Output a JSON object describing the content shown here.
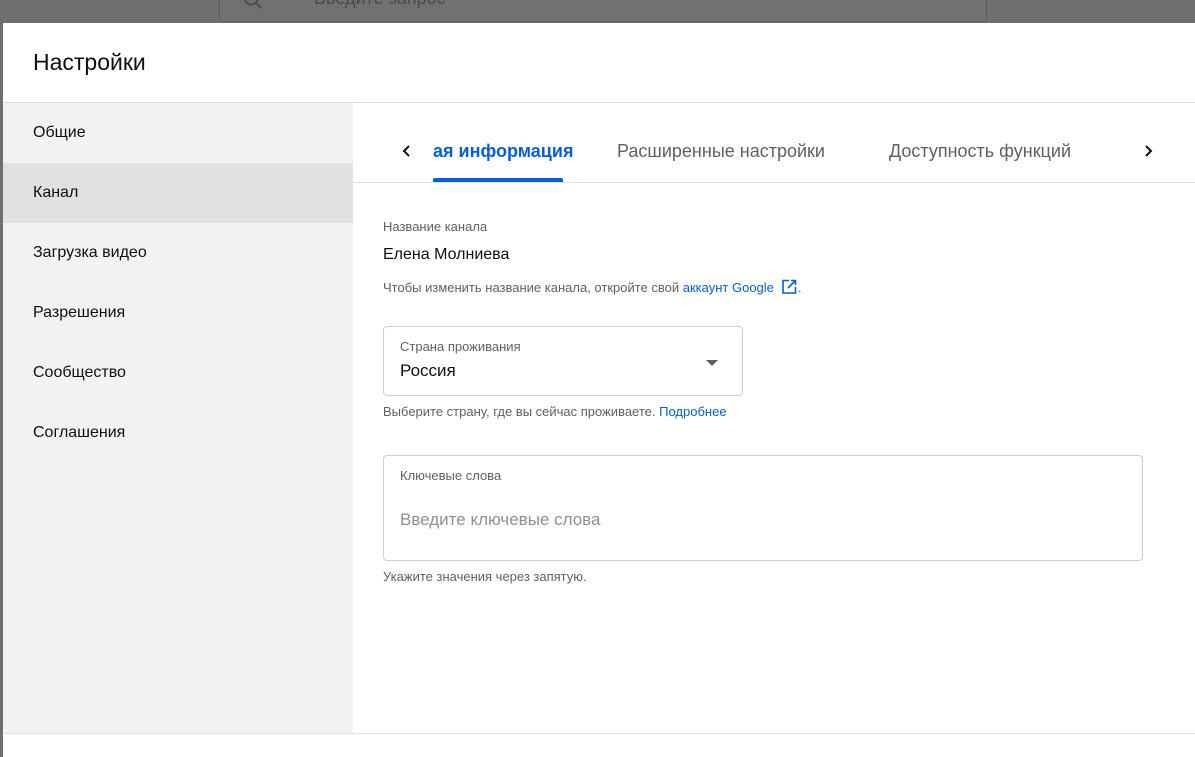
{
  "background": {
    "search_placeholder": "Введите запрос"
  },
  "dialog": {
    "title": "Настройки"
  },
  "sidebar": {
    "items": [
      {
        "label": "Общие",
        "active": false
      },
      {
        "label": "Канал",
        "active": true
      },
      {
        "label": "Загрузка видео",
        "active": false
      },
      {
        "label": "Разрешения",
        "active": false
      },
      {
        "label": "Сообщество",
        "active": false
      },
      {
        "label": "Соглашения",
        "active": false
      }
    ]
  },
  "tabs": {
    "items": [
      {
        "label": "ая информация",
        "active": true
      },
      {
        "label": "Расширенные настройки",
        "active": false
      },
      {
        "label": "Доступность функций",
        "active": false
      }
    ],
    "prev_icon": "chevron-left-icon",
    "next_icon": "chevron-right-icon"
  },
  "channel": {
    "name_label": "Название канала",
    "name_value": "Елена Молниева",
    "helper_text": "Чтобы изменить название канала, откройте свой",
    "helper_link": "аккаунт Google",
    "helper_end": "."
  },
  "country": {
    "label": "Страна проживания",
    "value": "Россия",
    "helper_text": "Выберите страну, где вы сейчас проживаете.",
    "helper_link": "Подробнее"
  },
  "keywords": {
    "label": "Ключевые слова",
    "placeholder": "Введите ключевые слова",
    "value": "",
    "helper_text": "Укажите значения через запятую."
  },
  "colors": {
    "accent": "#065fd4",
    "sidebar_bg": "#f2f2f2",
    "sidebar_active": "#e1e1e1"
  }
}
